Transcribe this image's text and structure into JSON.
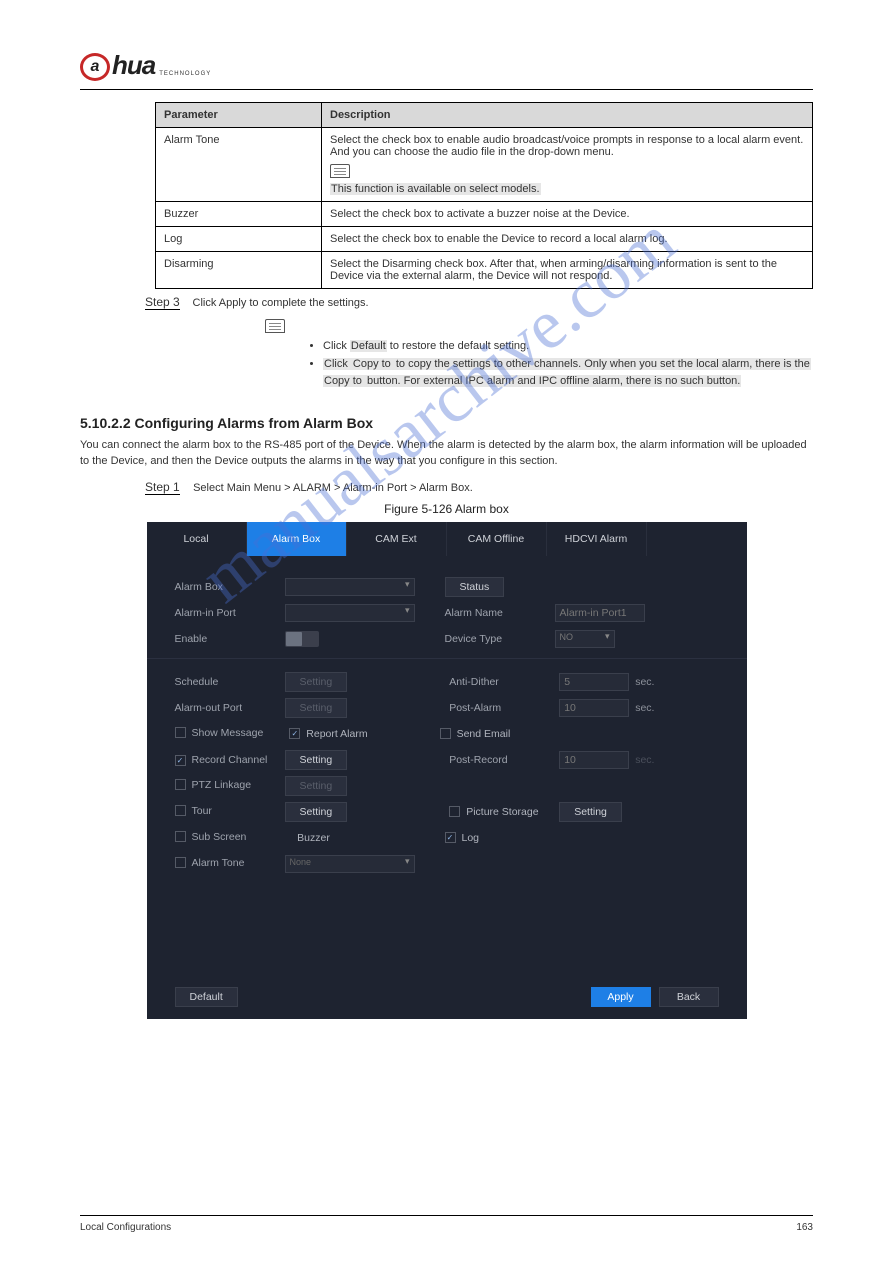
{
  "logo": {
    "mark": "a",
    "text": "hua",
    "sub": "TECHNOLOGY"
  },
  "table": {
    "head_param": "Parameter",
    "head_desc": "Description",
    "r1_param": "Alarm Tone",
    "r1_l1": "Select the check box to enable audio broadcast/voice prompts in response to a local alarm event. And you can choose the audio file in the drop-down menu.",
    "r1_note_hl": "This function is available on select models.",
    "r2_param": "Buzzer",
    "r2_desc": "Select the check box to activate a buzzer noise at the Device.",
    "r3_param": "Log",
    "r3_desc": "Select the check box to enable the Device to record a local alarm log.",
    "r4_param": "Disarming",
    "r4_l1": "Select the Disarming check box. After that, when arming/disarming information is sent to the Device via the external alarm, the Device will not respond.",
    "r4_l2": ""
  },
  "step3_label": "Step 3",
  "step3_text": "Click Apply to complete the settings.",
  "note_li1_a": "Click ",
  "note_li1_b": "Default",
  "note_li1_c": " to restore the default setting.",
  "note_li2_a": "Click ",
  "note_li2_b": "Copy to",
  "note_li2_c": " to copy the settings to other channels. Only when you set the local alarm, there is the ",
  "note_li2_d": "Copy to",
  "note_li2_e": " button. For external IPC alarm and IPC offline alarm, there is no such button.",
  "section_no": "5.10.2.2",
  "section_title": " Configuring Alarms from Alarm Box",
  "body_p1": "You can connect the alarm box to the RS-485 port of the Device. When the alarm is detected by the alarm box, the alarm information will be uploaded to the Device, and then the Device outputs the alarms in the way that you configure in this section.",
  "step1_label": "Step 1",
  "step1_text": "Select Main Menu > ALARM > Alarm-in Port > Alarm Box.",
  "figure_caption": "Figure 5-126 Alarm box",
  "ui": {
    "tabs": {
      "local": "Local",
      "alarm_box": "Alarm Box",
      "cam_ext": "CAM Ext",
      "cam_offline": "CAM Offline",
      "hdcvi": "HDCVI Alarm"
    },
    "labels": {
      "alarm_box": "Alarm Box",
      "status": "Status",
      "alarm_in_port": "Alarm-in Port",
      "alarm_name": "Alarm Name",
      "enable": "Enable",
      "device_type": "Device Type",
      "schedule": "Schedule",
      "anti_dither": "Anti-Dither",
      "alarm_out_port": "Alarm-out Port",
      "post_alarm": "Post-Alarm",
      "show_message": "Show Message",
      "report_alarm": "Report Alarm",
      "send_email": "Send Email",
      "record_channel": "Record Channel",
      "post_record": "Post-Record",
      "ptz_linkage": "PTZ Linkage",
      "tour": "Tour",
      "picture_storage": "Picture Storage",
      "sub_screen": "Sub Screen",
      "buzzer": "Buzzer",
      "log": "Log",
      "alarm_tone": "Alarm Tone"
    },
    "values": {
      "alarm_name_ph": "Alarm-in Port1",
      "device_type_val": "NO",
      "anti_dither_val": "5",
      "post_alarm_val": "10",
      "post_record_val": "10",
      "sec": "sec.",
      "none": "None",
      "setting": "Setting",
      "setting_dim": "Setting"
    },
    "buttons": {
      "default": "Default",
      "apply": "Apply",
      "back": "Back"
    }
  },
  "footer": {
    "left": "Local Configurations",
    "right": "163"
  },
  "watermark": "manualsarchive.com"
}
